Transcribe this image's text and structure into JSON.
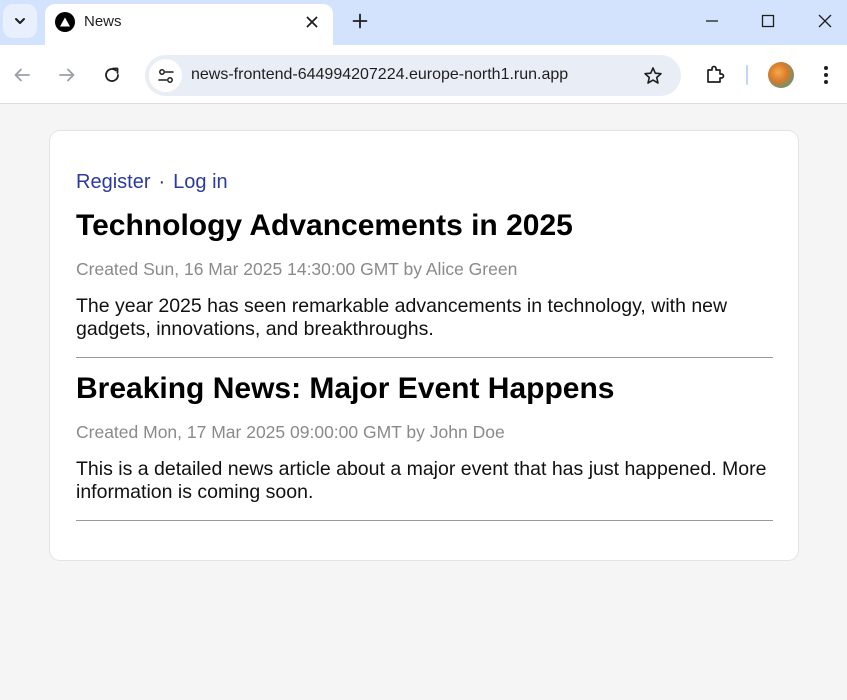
{
  "browser": {
    "tab": {
      "title": "News",
      "favicon": "triangle-logo-icon"
    },
    "url": "news-frontend-644994207224.europe-north1.run.app",
    "icons": [
      "tab-search-icon",
      "close-icon",
      "plus-icon",
      "minimize-icon",
      "maximize-icon",
      "close-window-icon",
      "back-icon",
      "forward-icon",
      "reload-icon",
      "site-settings-icon",
      "star-icon",
      "extensions-icon",
      "avatar",
      "kebab-menu-icon"
    ]
  },
  "auth": {
    "register": "Register",
    "separator": "·",
    "login": "Log in"
  },
  "articles": [
    {
      "title": "Technology Advancements in 2025",
      "meta": "Created Sun, 16 Mar 2025 14:30:00 GMT by Alice Green",
      "body": "The year 2025 has seen remarkable advancements in technology, with new gadgets, innovations, and breakthroughs."
    },
    {
      "title": "Breaking News: Major Event Happens",
      "meta": "Created Mon, 17 Mar 2025 09:00:00 GMT by John Doe",
      "body": "This is a detailed news article about a major event that has just happened. More information is coming soon."
    }
  ],
  "colors": {
    "tabstrip": "#d3e3fd",
    "link": "#2b3aa0",
    "meta": "#8a8a8a",
    "page_bg": "#f5f5f5"
  }
}
